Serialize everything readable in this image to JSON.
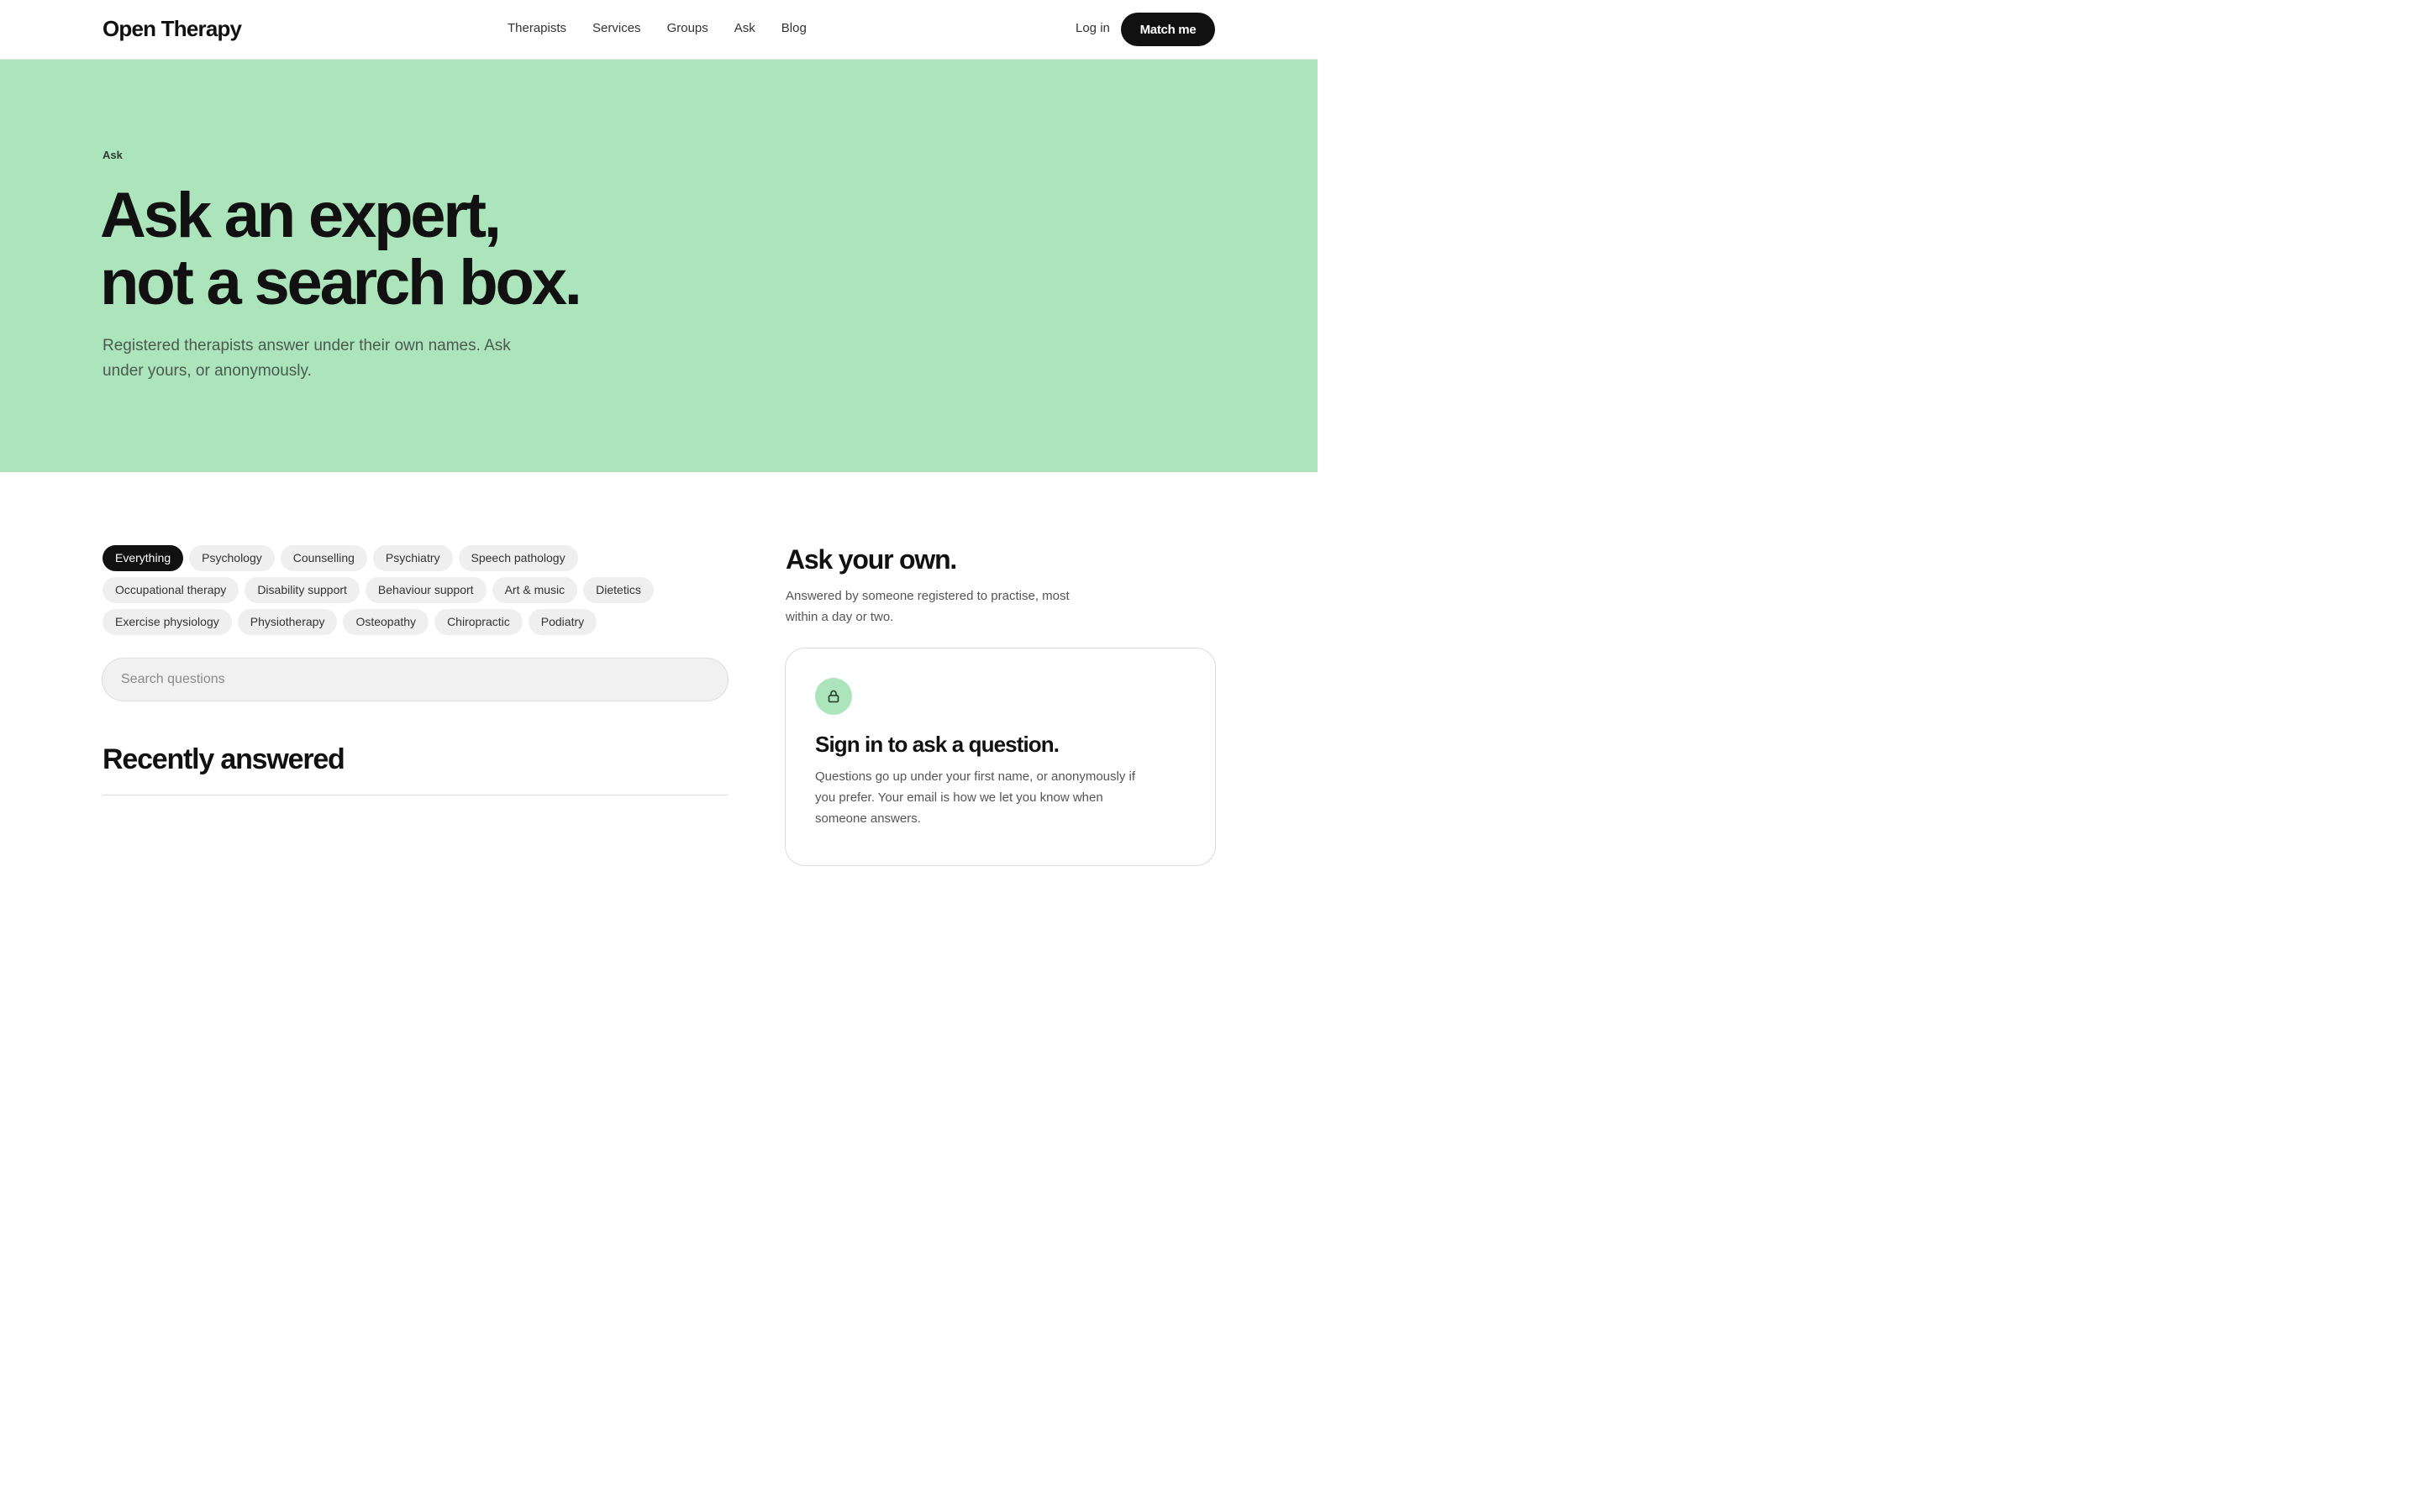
{
  "header": {
    "logo": "Open Therapy",
    "nav": [
      "Therapists",
      "Services",
      "Groups",
      "Ask",
      "Blog"
    ],
    "login_label": "Log in",
    "cta_label": "Match me"
  },
  "hero": {
    "eyebrow": "Ask",
    "title_line1": "Ask an expert,",
    "title_line2": "not a search box.",
    "subtitle": "Registered therapists answer under their own names. Ask under yours, or anonymously.",
    "background": "#ace5bb"
  },
  "filters": {
    "rows": [
      [
        "Everything",
        "Psychology",
        "Counselling",
        "Psychiatry",
        "Speech pathology"
      ],
      [
        "Occupational therapy",
        "Disability support",
        "Behaviour support",
        "Art & music",
        "Dietetics"
      ],
      [
        "Exercise physiology",
        "Physiotherapy",
        "Osteopathy",
        "Chiropractic",
        "Podiatry"
      ]
    ],
    "active": "Everything"
  },
  "search": {
    "placeholder": "Search questions"
  },
  "recent": {
    "title": "Recently answered"
  },
  "ask": {
    "title": "Ask your own.",
    "subtitle": "Answered by someone registered to practise, most within a day or two.",
    "card": {
      "icon": "lock-icon",
      "title": "Sign in to ask a question.",
      "text": "Questions go up under your first name, or anonymously if you prefer. Your email is how we let you know when someone answers."
    }
  }
}
